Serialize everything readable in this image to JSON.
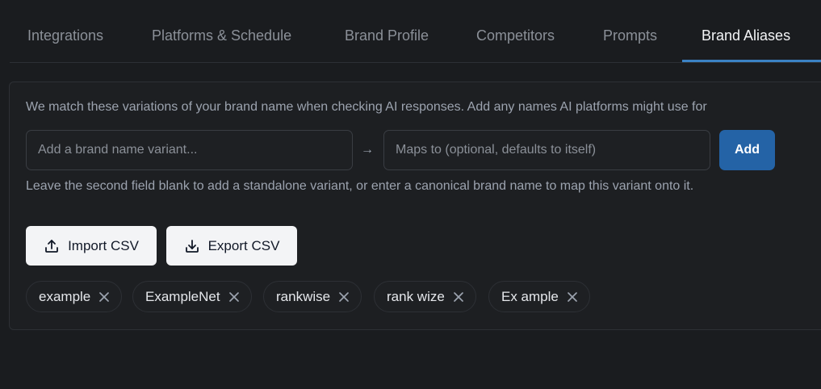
{
  "tabs": [
    {
      "label": "Integrations"
    },
    {
      "label": "Platforms & Schedule"
    },
    {
      "label": "Brand Profile"
    },
    {
      "label": "Competitors"
    },
    {
      "label": "Prompts"
    },
    {
      "label": "Brand Aliases",
      "active": true
    }
  ],
  "panel": {
    "description": "We match these variations of your brand name when checking AI responses. Add any names AI platforms might use for",
    "variant_input": {
      "placeholder": "Add a brand name variant...",
      "value": ""
    },
    "arrow": "→",
    "maps_to_input": {
      "placeholder": "Maps to (optional, defaults to itself)",
      "value": ""
    },
    "add_label": "Add",
    "help_text": "Leave the second field blank to add a standalone variant, or enter a canonical brand name to map this variant onto it.",
    "import_label": "Import CSV",
    "export_label": "Export CSV",
    "aliases": [
      {
        "label": "example"
      },
      {
        "label": "ExampleNet"
      },
      {
        "label": "rankwise"
      },
      {
        "label": "rank wize"
      },
      {
        "label": "Ex ample"
      }
    ]
  },
  "colors": {
    "background": "#1a1c1f",
    "accent": "#2463a6",
    "active_tab_underline": "#3b82c4"
  }
}
